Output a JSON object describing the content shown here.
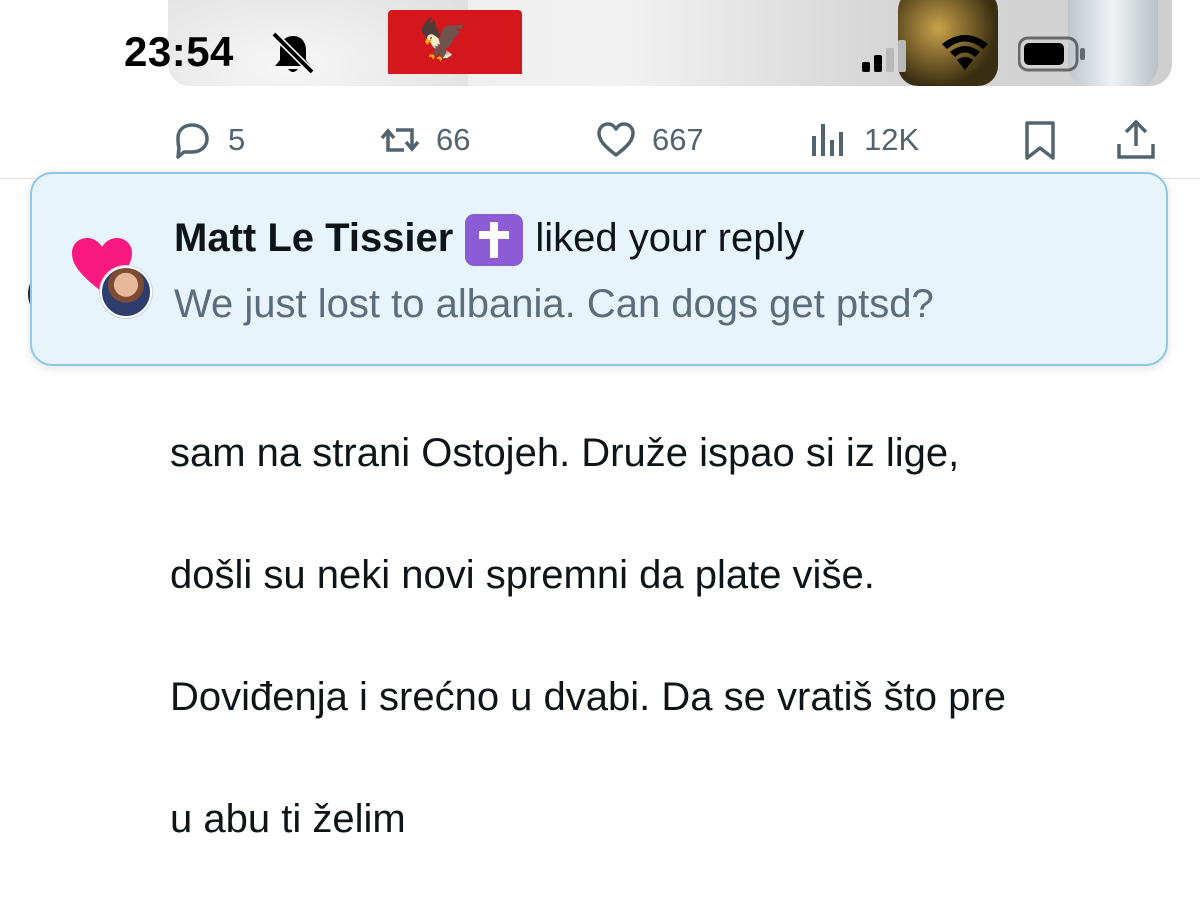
{
  "status_bar": {
    "time": "23:54",
    "icons": [
      "bell-slash-icon",
      "signal-icon",
      "wifi-icon",
      "battery-icon"
    ]
  },
  "media": {
    "description_icon": "albanian-flag-image"
  },
  "actions": {
    "reply_count": "5",
    "retweet_count": "66",
    "like_count": "667",
    "view_count": "12K"
  },
  "notification": {
    "user_name": "Matt Le Tissier",
    "badge_icon": "latin-cross-emoji",
    "action_text": "liked your reply",
    "reply_preview": "We just lost to albania. Can dogs get ptsd?"
  },
  "reply_body": {
    "lines": [
      "sam na strani Ostojeh. Druže ispao si iz lige,",
      "došli su neki novi spremni da plate više.",
      "Doviđenja i srećno u dvabi. Da se vratiš što pre",
      "u abu ti želim"
    ]
  },
  "colors": {
    "toast_bg": "#e8f4fb",
    "toast_border": "#8ec7e8",
    "heart": "#f91880",
    "muted_text": "#536471",
    "badge": "#8b5cd6"
  }
}
